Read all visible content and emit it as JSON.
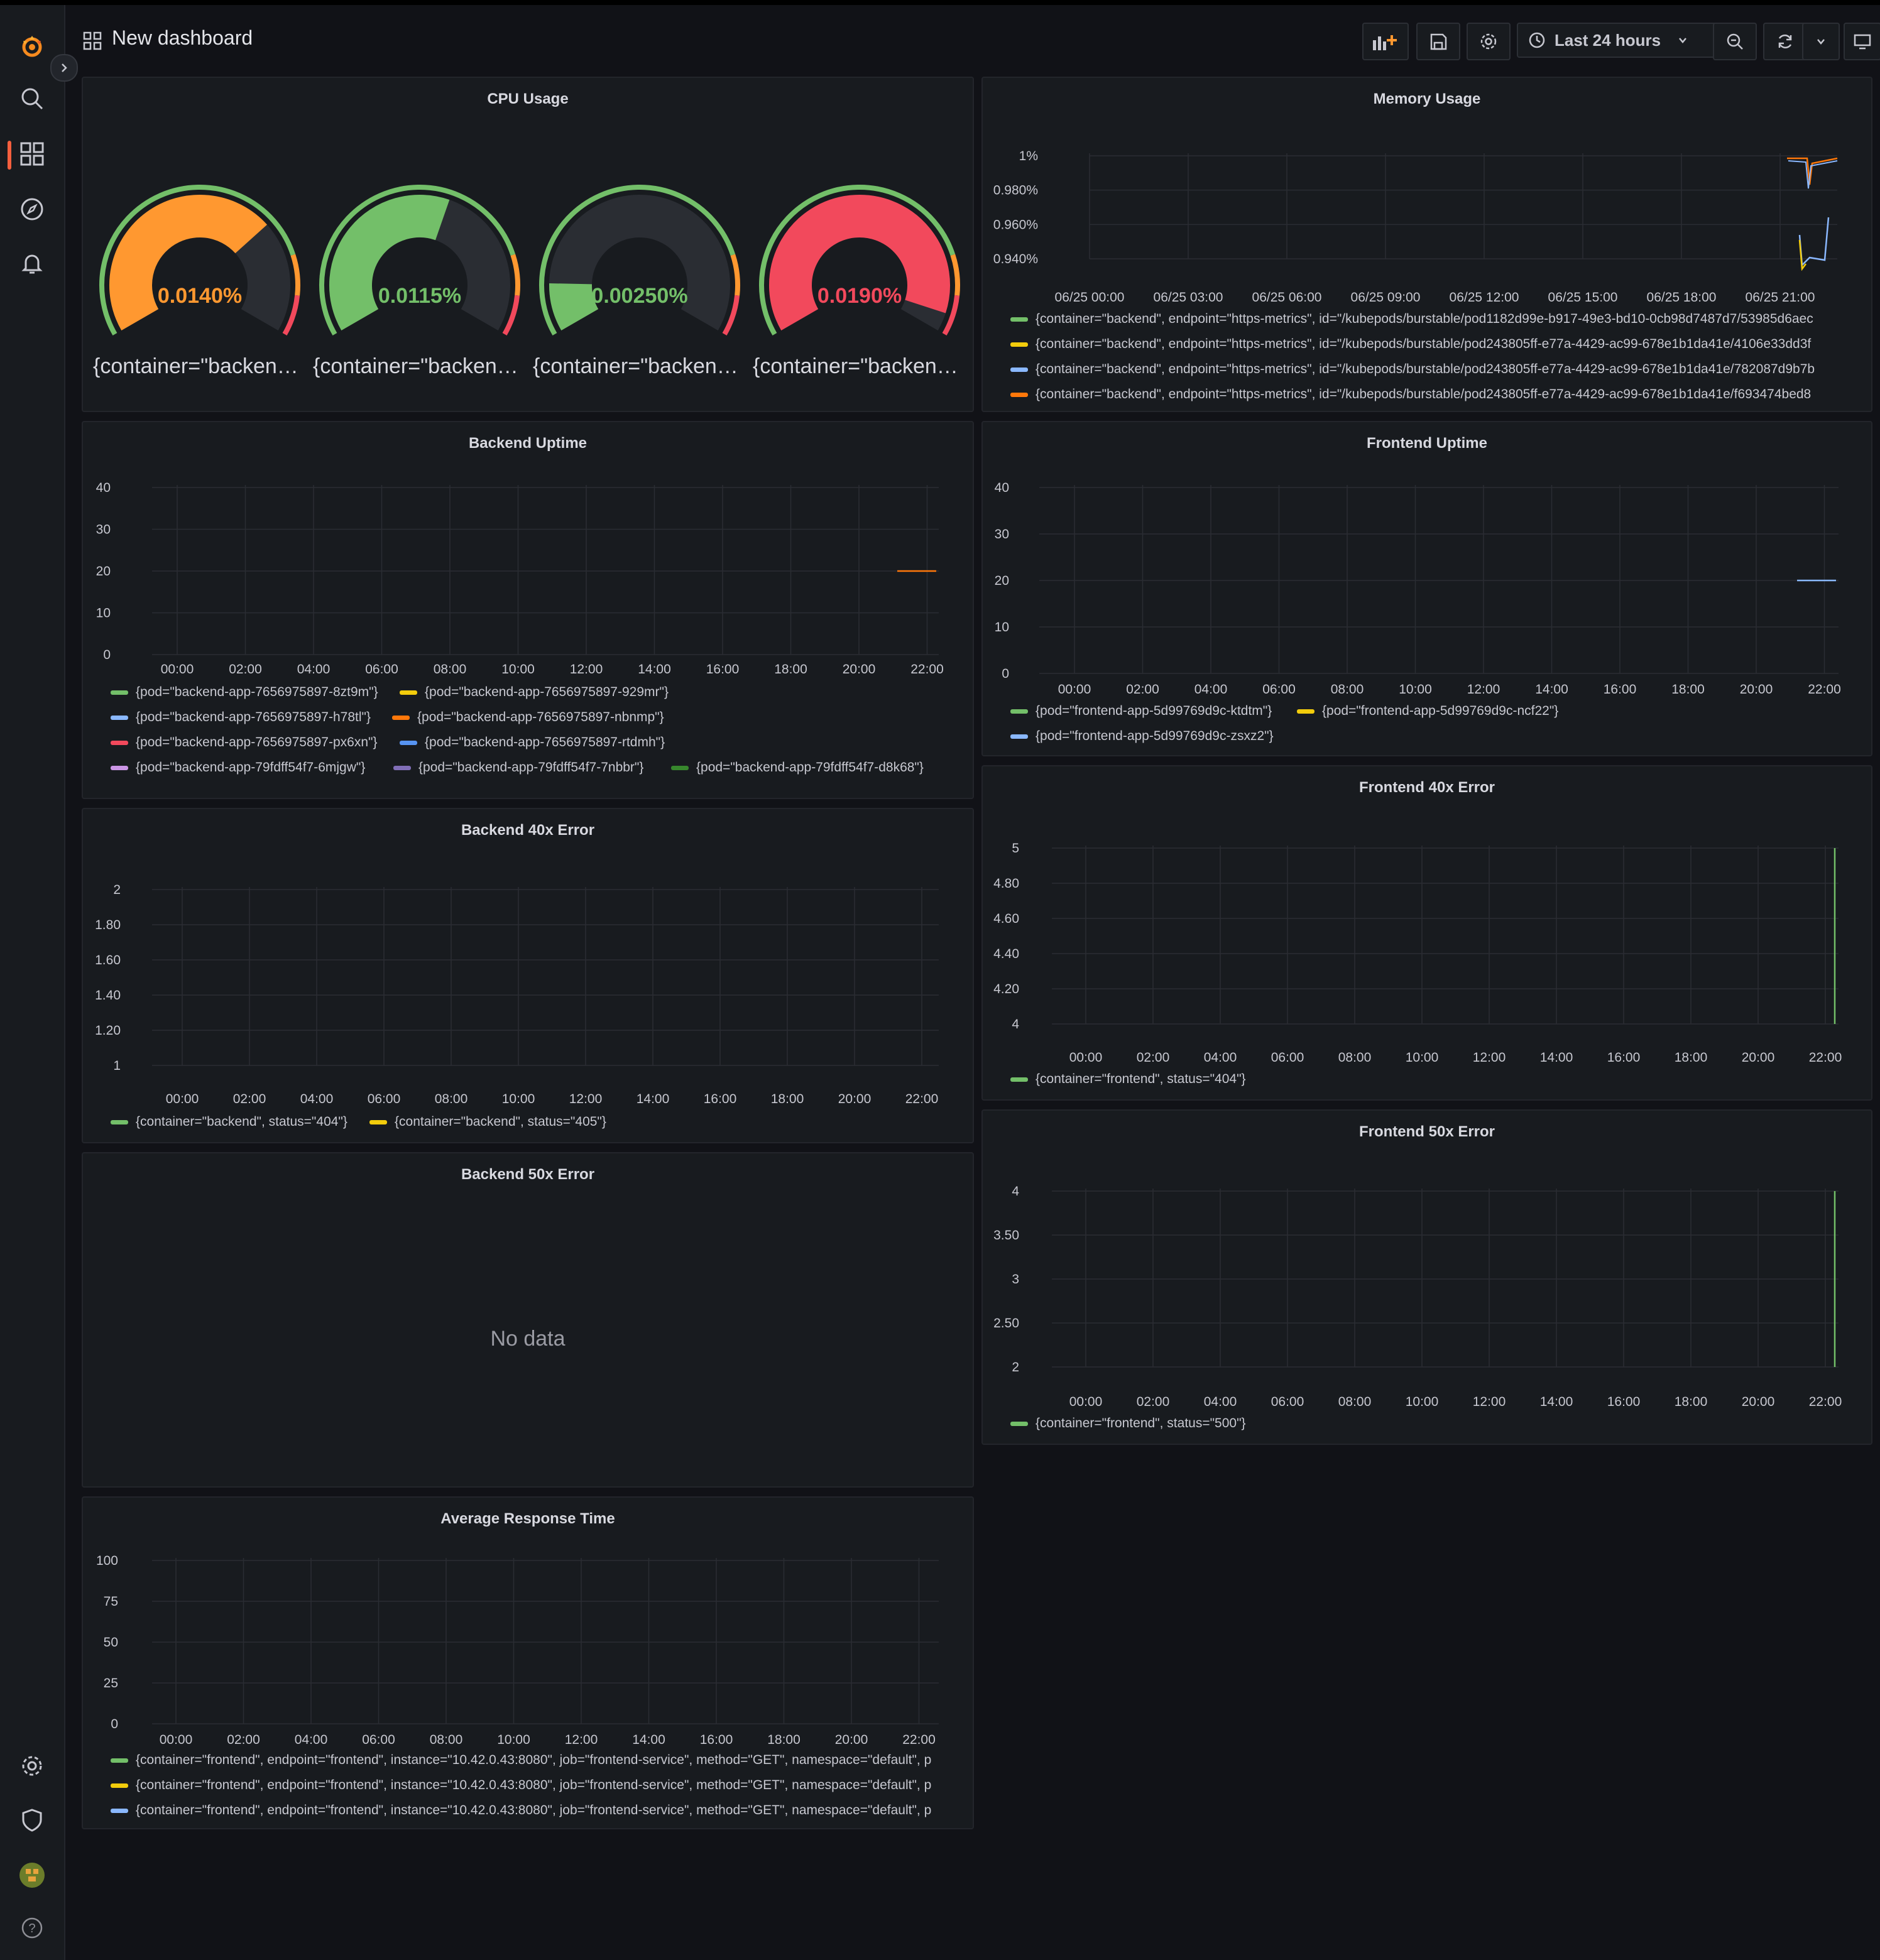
{
  "header": {
    "title": "New dashboard",
    "time_range": "Last 24 hours"
  },
  "sidebar": {
    "items": [
      {
        "name": "search",
        "icon": "search-icon"
      },
      {
        "name": "dashboards",
        "icon": "dashboards-icon"
      },
      {
        "name": "explore",
        "icon": "compass-icon"
      },
      {
        "name": "alerting",
        "icon": "bell-icon"
      }
    ],
    "bottom_items": [
      {
        "name": "configuration",
        "icon": "gear-icon"
      },
      {
        "name": "server-admin",
        "icon": "shield-icon"
      },
      {
        "name": "profile",
        "icon": "avatar"
      },
      {
        "name": "help",
        "icon": "help-icon"
      }
    ]
  },
  "colors": {
    "green": "#73bf69",
    "yellow": "#f2cc0c",
    "blue": "#8ab8ff",
    "orange": "#ff780a",
    "red": "#f2495c",
    "purple": "#ca95e5",
    "gauge_orange": "#ff9830",
    "accent": "#f55f3e"
  },
  "panels": {
    "cpu": {
      "title": "CPU Usage",
      "gauges": [
        {
          "value_text": "0.0140%",
          "fraction": 0.7,
          "color": "#ff9830",
          "label": "{container=\"backend..."
        },
        {
          "value_text": "0.0115%",
          "fraction": 0.58,
          "color": "#73bf69",
          "label": "{container=\"backend..."
        },
        {
          "value_text": "0.00250%",
          "fraction": 0.13,
          "color": "#73bf69",
          "label": "{container=\"backend..."
        },
        {
          "value_text": "0.0190%",
          "fraction": 0.95,
          "color": "#f2495c",
          "label": "{container=\"backend..."
        }
      ]
    },
    "memory": {
      "title": "Memory Usage",
      "y_ticks": [
        "1%",
        "0.980%",
        "0.960%",
        "0.940%"
      ],
      "x_ticks": [
        "06/25 00:00",
        "06/25 03:00",
        "06/25 06:00",
        "06/25 09:00",
        "06/25 12:00",
        "06/25 15:00",
        "06/25 18:00",
        "06/25 21:00"
      ],
      "legend": [
        {
          "color": "#73bf69",
          "text": "{container=\"backend\", endpoint=\"https-metrics\", id=\"/kubepods/burstable/pod1182d99e-b917-49e3-bd10-0cb98d7487d7/53985d6aec"
        },
        {
          "color": "#f2cc0c",
          "text": "{container=\"backend\", endpoint=\"https-metrics\", id=\"/kubepods/burstable/pod243805ff-e77a-4429-ac99-678e1b1da41e/4106e33dd3f"
        },
        {
          "color": "#8ab8ff",
          "text": "{container=\"backend\", endpoint=\"https-metrics\", id=\"/kubepods/burstable/pod243805ff-e77a-4429-ac99-678e1b1da41e/782087d9b7b"
        },
        {
          "color": "#ff780a",
          "text": "{container=\"backend\", endpoint=\"https-metrics\", id=\"/kubepods/burstable/pod243805ff-e77a-4429-ac99-678e1b1da41e/f693474bed8"
        }
      ]
    },
    "backend_uptime": {
      "title": "Backend Uptime",
      "y_ticks": [
        "40",
        "30",
        "20",
        "10",
        "0"
      ],
      "x_ticks": [
        "00:00",
        "02:00",
        "04:00",
        "06:00",
        "08:00",
        "10:00",
        "12:00",
        "14:00",
        "16:00",
        "18:00",
        "20:00",
        "22:00"
      ],
      "legend": [
        {
          "color": "#73bf69",
          "text": "{pod=\"backend-app-7656975897-8zt9m\"}"
        },
        {
          "color": "#f2cc0c",
          "text": "{pod=\"backend-app-7656975897-929mr\"}"
        },
        {
          "color": "#8ab8ff",
          "text": "{pod=\"backend-app-7656975897-h78tl\"}"
        },
        {
          "color": "#ff780a",
          "text": "{pod=\"backend-app-7656975897-nbnmp\"}"
        },
        {
          "color": "#f2495c",
          "text": "{pod=\"backend-app-7656975897-px6xn\"}"
        },
        {
          "color": "#5794f2",
          "text": "{pod=\"backend-app-7656975897-rtdmh\"}"
        },
        {
          "color": "#ca95e5",
          "text": "{pod=\"backend-app-79fdff54f7-6mjgw\"}"
        },
        {
          "color": "#806eb7",
          "text": "{pod=\"backend-app-79fdff54f7-7nbbr\"}"
        },
        {
          "color": "#37872d",
          "text": "{pod=\"backend-app-79fdff54f7-d8k68\"}"
        }
      ]
    },
    "frontend_uptime": {
      "title": "Frontend Uptime",
      "y_ticks": [
        "40",
        "30",
        "20",
        "10",
        "0"
      ],
      "x_ticks": [
        "00:00",
        "02:00",
        "04:00",
        "06:00",
        "08:00",
        "10:00",
        "12:00",
        "14:00",
        "16:00",
        "18:00",
        "20:00",
        "22:00"
      ],
      "legend": [
        {
          "color": "#73bf69",
          "text": "{pod=\"frontend-app-5d99769d9c-ktdtm\"}"
        },
        {
          "color": "#f2cc0c",
          "text": "{pod=\"frontend-app-5d99769d9c-ncf22\"}"
        },
        {
          "color": "#8ab8ff",
          "text": "{pod=\"frontend-app-5d99769d9c-zsxz2\"}"
        }
      ]
    },
    "backend_40x": {
      "title": "Backend 40x Error",
      "y_ticks": [
        "2",
        "1.80",
        "1.60",
        "1.40",
        "1.20",
        "1"
      ],
      "x_ticks": [
        "00:00",
        "02:00",
        "04:00",
        "06:00",
        "08:00",
        "10:00",
        "12:00",
        "14:00",
        "16:00",
        "18:00",
        "20:00",
        "22:00"
      ],
      "legend": [
        {
          "color": "#73bf69",
          "text": "{container=\"backend\", status=\"404\"}"
        },
        {
          "color": "#f2cc0c",
          "text": "{container=\"backend\", status=\"405\"}"
        }
      ]
    },
    "frontend_40x": {
      "title": "Frontend 40x Error",
      "y_ticks": [
        "5",
        "4.80",
        "4.60",
        "4.40",
        "4.20",
        "4"
      ],
      "x_ticks": [
        "00:00",
        "02:00",
        "04:00",
        "06:00",
        "08:00",
        "10:00",
        "12:00",
        "14:00",
        "16:00",
        "18:00",
        "20:00",
        "22:00"
      ],
      "legend": [
        {
          "color": "#73bf69",
          "text": "{container=\"frontend\", status=\"404\"}"
        }
      ]
    },
    "backend_50x": {
      "title": "Backend 50x Error",
      "no_data": "No data"
    },
    "frontend_50x": {
      "title": "Frontend 50x Error",
      "y_ticks": [
        "4",
        "3.50",
        "3",
        "2.50",
        "2"
      ],
      "x_ticks": [
        "00:00",
        "02:00",
        "04:00",
        "06:00",
        "08:00",
        "10:00",
        "12:00",
        "14:00",
        "16:00",
        "18:00",
        "20:00",
        "22:00"
      ],
      "legend": [
        {
          "color": "#73bf69",
          "text": "{container=\"frontend\", status=\"500\"}"
        }
      ]
    },
    "avg_response": {
      "title": "Average Response Time",
      "y_ticks": [
        "100",
        "75",
        "50",
        "25",
        "0"
      ],
      "x_ticks": [
        "00:00",
        "02:00",
        "04:00",
        "06:00",
        "08:00",
        "10:00",
        "12:00",
        "14:00",
        "16:00",
        "18:00",
        "20:00",
        "22:00"
      ],
      "legend": [
        {
          "color": "#73bf69",
          "text": "{container=\"frontend\", endpoint=\"frontend\", instance=\"10.42.0.43:8080\", job=\"frontend-service\", method=\"GET\", namespace=\"default\", p"
        },
        {
          "color": "#f2cc0c",
          "text": "{container=\"frontend\", endpoint=\"frontend\", instance=\"10.42.0.43:8080\", job=\"frontend-service\", method=\"GET\", namespace=\"default\", p"
        },
        {
          "color": "#8ab8ff",
          "text": "{container=\"frontend\", endpoint=\"frontend\", instance=\"10.42.0.43:8080\", job=\"frontend-service\", method=\"GET\", namespace=\"default\", p"
        }
      ]
    }
  }
}
